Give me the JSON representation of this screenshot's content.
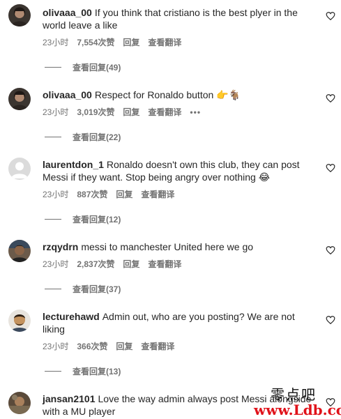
{
  "comments": [
    {
      "username": "olivaaa_00",
      "text": "If you think that cristiano is the best plyer in the world leave a like",
      "time": "23小时",
      "likes": "7,554次赞",
      "reply_label": "回复",
      "translate_label": "查看翻译",
      "view_replies": "查看回复(49)"
    },
    {
      "username": "olivaaa_00",
      "text": "Respect for Ronaldo button 👉🐐",
      "time": "23小时",
      "likes": "3,019次赞",
      "reply_label": "回复",
      "translate_label": "查看翻译",
      "more": "•••",
      "view_replies": "查看回复(22)"
    },
    {
      "username": "laurentdon_1",
      "text": "Ronaldo doesn't own this club, they can post Messi if they want. Stop being angry over nothing 😂",
      "time": "23小时",
      "likes": "887次赞",
      "reply_label": "回复",
      "translate_label": "查看翻译",
      "view_replies": "查看回复(12)"
    },
    {
      "username": "rzqydrn",
      "text": "messi to manchester United here we go",
      "time": "23小时",
      "likes": "2,837次赞",
      "reply_label": "回复",
      "translate_label": "查看翻译",
      "view_replies": "查看回复(37)"
    },
    {
      "username": "lecturehawd",
      "text": "Admin out, who are you posting? We are not liking",
      "time": "23小时",
      "likes": "366次赞",
      "reply_label": "回复",
      "translate_label": "查看翻译",
      "view_replies": "查看回复(13)"
    },
    {
      "username": "jansan2101",
      "text": "Love the way admin always post Messi alongside with a MU player"
    }
  ],
  "watermark": {
    "chinese": "零点吧",
    "url": "www.Ldb.cc"
  },
  "colors": {
    "text": "#262626",
    "secondary": "#737373",
    "watermark_red": "#e0121a"
  }
}
